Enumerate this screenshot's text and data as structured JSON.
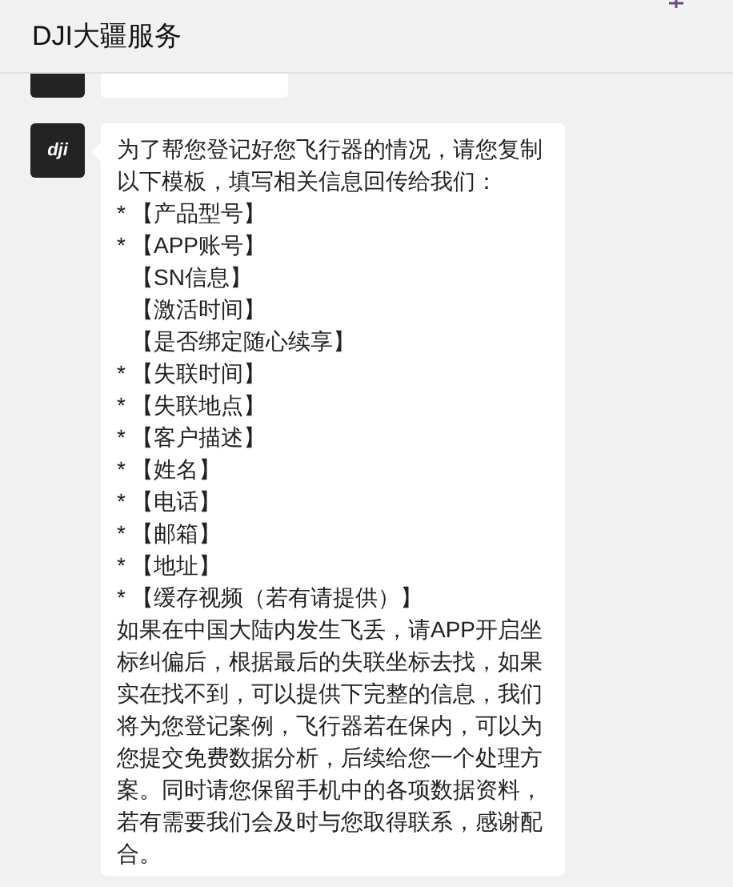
{
  "header": {
    "title": "DJI大疆服务"
  },
  "messages": [
    {
      "kind": "cut_off"
    },
    {
      "avatar": {
        "logo": "dji"
      },
      "intro": "为了帮您登记好您飞行器的情况，请您复制以下模板，填写相关信息回传给我们：",
      "fields": [
        {
          "marker": "*",
          "label": "【产品型号】"
        },
        {
          "marker": "*",
          "label": "【APP账号】"
        },
        {
          "label": "【SN信息】"
        },
        {
          "label": "【激活时间】"
        },
        {
          "label": "【是否绑定随心续享】"
        },
        {
          "marker": "*",
          "label": "【失联时间】"
        },
        {
          "marker": "*",
          "label": "【失联地点】"
        },
        {
          "marker": "*",
          "label": "【客户描述】"
        },
        {
          "marker": "*",
          "label": "【姓名】"
        },
        {
          "marker": "*",
          "label": "【电话】"
        },
        {
          "marker": "*",
          "label": "【邮箱】"
        },
        {
          "marker": "*",
          "label": "【地址】"
        },
        {
          "marker": "*",
          "label": "【缓存视频（若有请提供）】"
        }
      ],
      "closing": "如果在中国大陆内发生飞丢，请APP开启坐标纠偏后，根据最后的失联坐标去找，如果实在找不到，可以提供下完整的信息，我们将为您登记案例，飞行器若在保内，可以为您提交免费数据分析，后续给您一个处理方案。同时请您保留手机中的各项数据资料，若有需要我们会及时与您取得联系，感谢配合。"
    }
  ]
}
